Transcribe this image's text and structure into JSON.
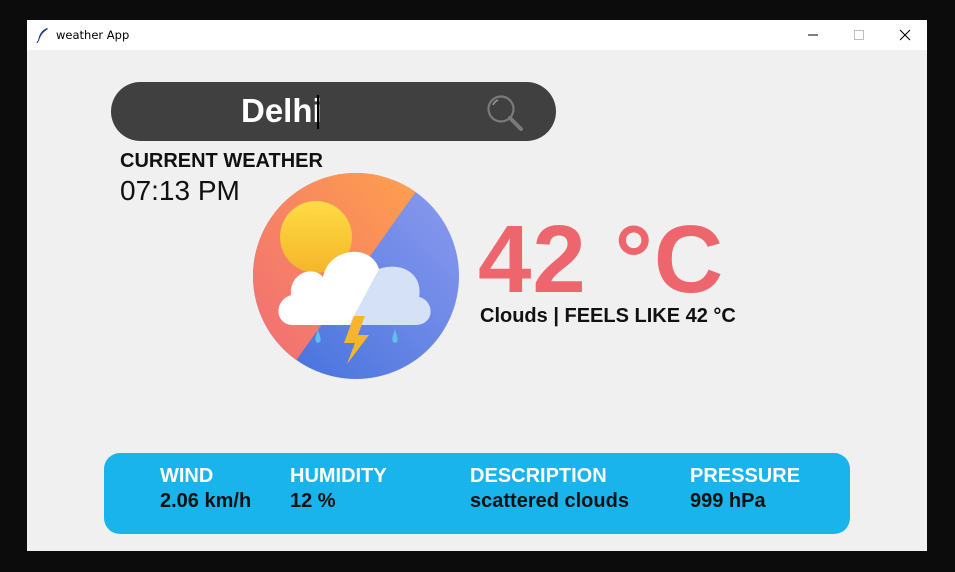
{
  "window": {
    "title": "weather App",
    "controls": [
      "minimize",
      "maximize",
      "close"
    ]
  },
  "search": {
    "value": "Delhi",
    "icon": "search-icon"
  },
  "current": {
    "label": "CURRENT WEATHER",
    "time": "07:13 PM"
  },
  "weather": {
    "icon": "cloud-thunder-rain-icon",
    "temperature": "42 °C",
    "summary": "Clouds | FEELS LIKE 42 °C",
    "temp_color": "#ee666d"
  },
  "details": {
    "accent": "#1ab4ec",
    "items": [
      {
        "label": "WIND",
        "value": "2.06 km/h"
      },
      {
        "label": "HUMIDITY",
        "value": "12 %"
      },
      {
        "label": "DESCRIPTION",
        "value": "scattered clouds"
      },
      {
        "label": "PRESSURE",
        "value": "999 hPa"
      }
    ]
  }
}
